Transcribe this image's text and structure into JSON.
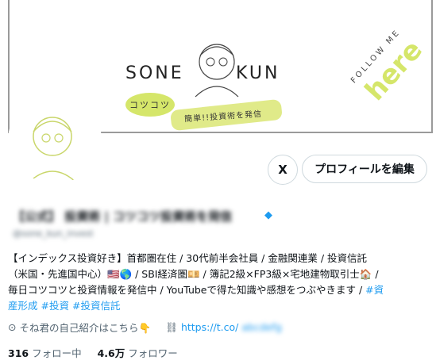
{
  "banner": {
    "brand_left": "SONE",
    "brand_right": "KUN",
    "pill_text": "コツコツ",
    "tagline": "簡単!!投資術を発信",
    "follow_text": "FOLLOW ME",
    "here_text": "here",
    "accent_color": "#d5e66a"
  },
  "actions": {
    "grok_label": "X",
    "edit_profile": "プロフィールを編集"
  },
  "profile": {
    "display_name": "【公式】 投資術 | コツコツ投資術を発信",
    "handle": "@sone_kun_invest",
    "bio_line1": "【インデックス投資好き】首都圏在住 / 30代前半会社員 / 金融関連業 / 投資信託",
    "bio_line2": "（米国・先進国中心）🇺🇸🌎 / SBI経済圏💴 / 簿記2級×FP3級×宅地建物取引士🏠 /",
    "bio_line3": "毎日コツコツと投資情報を発信中 / YouTubeで得た知識や感想をつぶやきます /",
    "bio_tag1": "#資",
    "bio_tag1_cont": "産形成",
    "bio_tag2": "#投資",
    "bio_tag3": "#投資信託",
    "location": "そね君の自己紹介はこちら👇",
    "link": "https://t.co/",
    "link_rest": "abcdefg"
  },
  "stats": {
    "following_count": "316",
    "following_label": "フォロー中",
    "followers_count": "4.6万",
    "followers_label": "フォロワー"
  }
}
